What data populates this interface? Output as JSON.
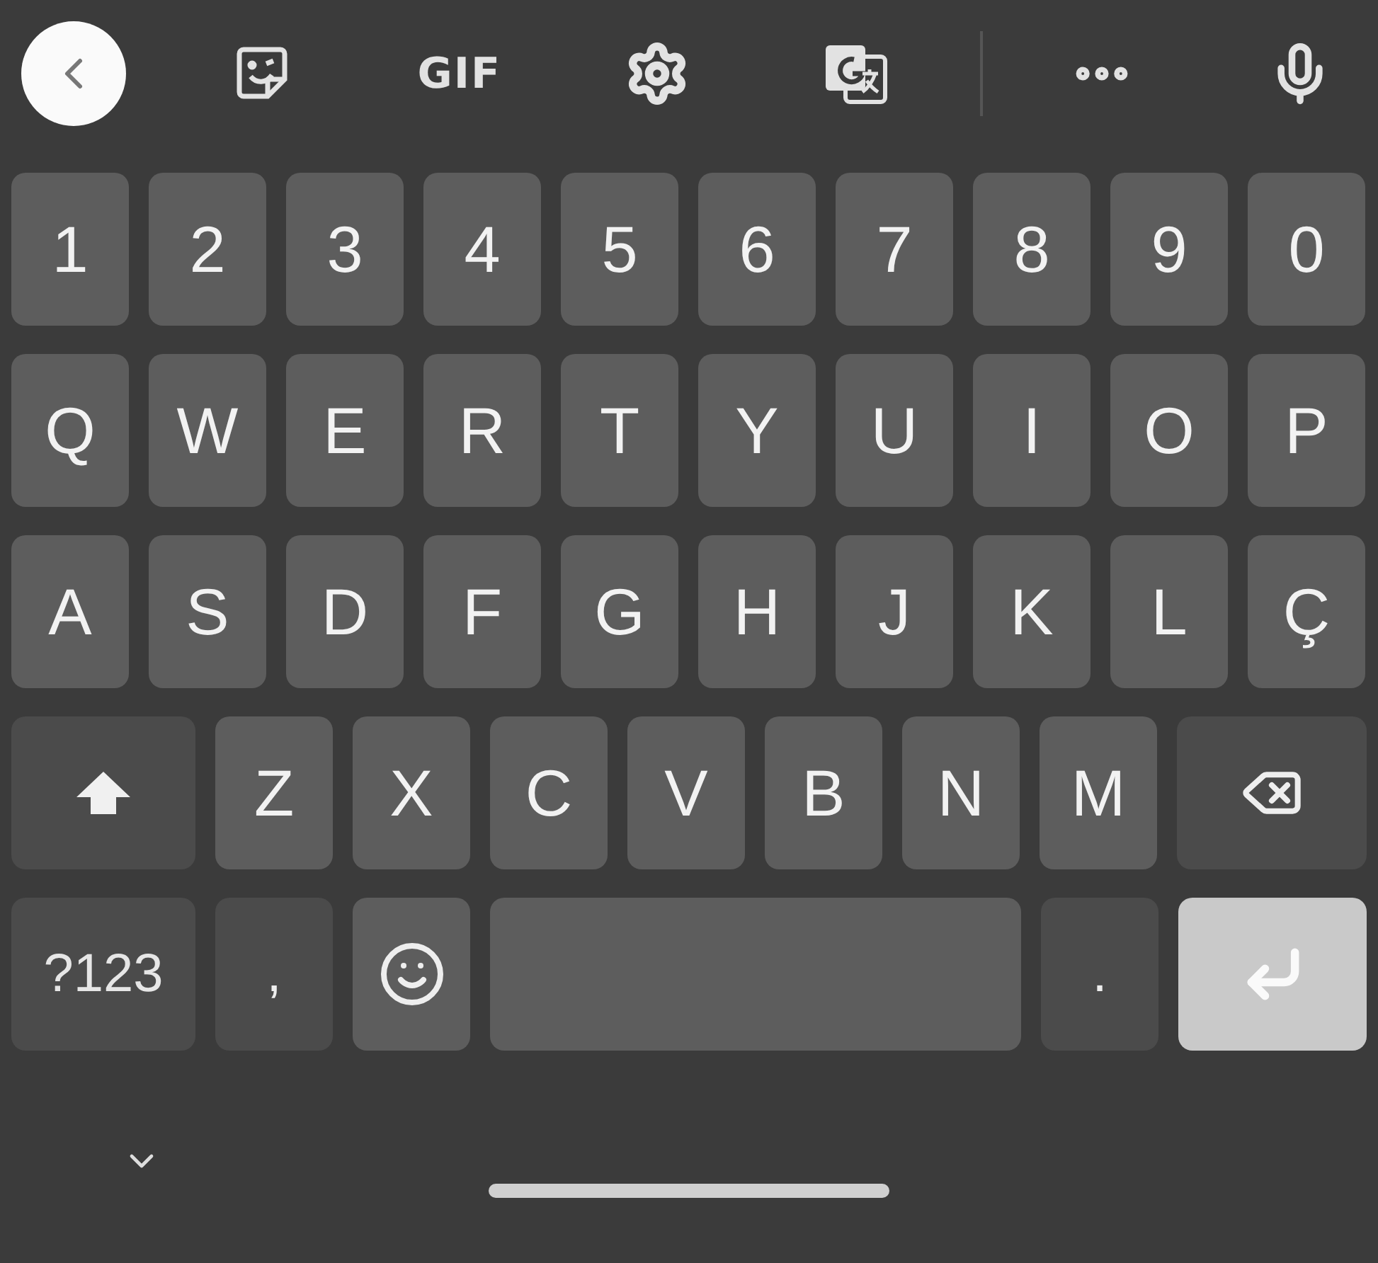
{
  "toolbar": [
    {
      "kind": "back"
    },
    {
      "kind": "sticker"
    },
    {
      "kind": "gif",
      "label": "GIF"
    },
    {
      "kind": "settings"
    },
    {
      "kind": "translate"
    },
    {
      "kind": "more"
    },
    {
      "kind": "mic"
    }
  ],
  "rows": [
    [
      {
        "kind": "char",
        "label": "1"
      },
      {
        "kind": "char",
        "label": "2"
      },
      {
        "kind": "char",
        "label": "3"
      },
      {
        "kind": "char",
        "label": "4"
      },
      {
        "kind": "char",
        "label": "5"
      },
      {
        "kind": "char",
        "label": "6"
      },
      {
        "kind": "char",
        "label": "7"
      },
      {
        "kind": "char",
        "label": "8"
      },
      {
        "kind": "char",
        "label": "9"
      },
      {
        "kind": "char",
        "label": "0"
      }
    ],
    [
      {
        "kind": "char",
        "label": "Q"
      },
      {
        "kind": "char",
        "label": "W"
      },
      {
        "kind": "char",
        "label": "E"
      },
      {
        "kind": "char",
        "label": "R"
      },
      {
        "kind": "char",
        "label": "T"
      },
      {
        "kind": "char",
        "label": "Y"
      },
      {
        "kind": "char",
        "label": "U"
      },
      {
        "kind": "char",
        "label": "I"
      },
      {
        "kind": "char",
        "label": "O"
      },
      {
        "kind": "char",
        "label": "P"
      }
    ],
    [
      {
        "kind": "char",
        "label": "A"
      },
      {
        "kind": "char",
        "label": "S"
      },
      {
        "kind": "char",
        "label": "D"
      },
      {
        "kind": "char",
        "label": "F"
      },
      {
        "kind": "char",
        "label": "G"
      },
      {
        "kind": "char",
        "label": "H"
      },
      {
        "kind": "char",
        "label": "J"
      },
      {
        "kind": "char",
        "label": "K"
      },
      {
        "kind": "char",
        "label": "L"
      },
      {
        "kind": "char",
        "label": "Ç"
      }
    ],
    [
      {
        "kind": "shift"
      },
      {
        "kind": "char",
        "label": "Z"
      },
      {
        "kind": "char",
        "label": "X"
      },
      {
        "kind": "char",
        "label": "C"
      },
      {
        "kind": "char",
        "label": "V"
      },
      {
        "kind": "char",
        "label": "B"
      },
      {
        "kind": "char",
        "label": "N"
      },
      {
        "kind": "char",
        "label": "M"
      },
      {
        "kind": "backspace"
      }
    ],
    [
      {
        "kind": "symbols",
        "label": "?123"
      },
      {
        "kind": "punct",
        "label": ","
      },
      {
        "kind": "emoji"
      },
      {
        "kind": "space"
      },
      {
        "kind": "punct",
        "label": "."
      },
      {
        "kind": "enter"
      }
    ]
  ],
  "nav": {
    "collapse": true
  }
}
